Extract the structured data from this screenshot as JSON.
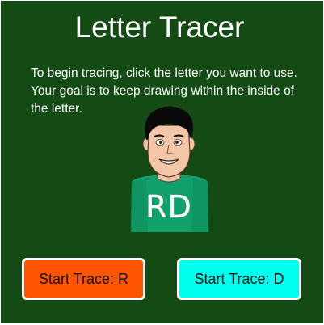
{
  "header": {
    "title": "Letter Tracer"
  },
  "instructions": "To begin tracing, click the letter you want to use. Your goal is to keep drawing within the inside of the letter.",
  "avatar": {
    "shirt_text": "RD"
  },
  "buttons": [
    {
      "label": "Start Trace: R",
      "color": "#ff5500"
    },
    {
      "label": "Start Trace: D",
      "color": "#00ffee"
    }
  ],
  "colors": {
    "background": "#144a14",
    "shirt": "#12a06a",
    "skin": "#f2c6a6",
    "hair": "#0a0a0a"
  }
}
